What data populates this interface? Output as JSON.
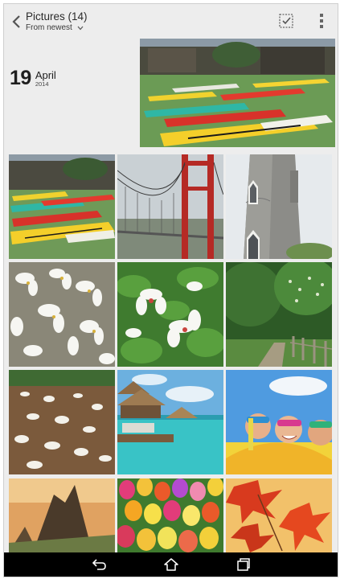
{
  "header": {
    "title": "Pictures (14)",
    "sort_label": "From newest",
    "back_icon": "chevron-left-icon",
    "select_icon": "select-all-icon",
    "more_icon": "more-vertical-icon"
  },
  "group": {
    "day": "19",
    "month": "April",
    "year": "2014"
  },
  "photos": [
    {
      "subject": "kayaks-on-grass"
    },
    {
      "subject": "kayaks-on-grass"
    },
    {
      "subject": "red-suspension-bridge"
    },
    {
      "subject": "stone-lighthouse"
    },
    {
      "subject": "white-flowers-on-ground"
    },
    {
      "subject": "white-flowers-on-leaves"
    },
    {
      "subject": "forest-path-with-fence"
    },
    {
      "subject": "blossoms-on-forest-floor"
    },
    {
      "subject": "overwater-bungalows"
    },
    {
      "subject": "kids-on-pool-float"
    },
    {
      "subject": "mountain-ruins"
    },
    {
      "subject": "colorful-tulips"
    },
    {
      "subject": "autumn-maple-leaves"
    }
  ],
  "navbar": {
    "back_icon": "nav-back-icon",
    "home_icon": "nav-home-icon",
    "recents_icon": "nav-recents-icon"
  },
  "colors": {
    "background": "#ededed",
    "text": "#2b2b2b",
    "navbar": "#000000"
  }
}
